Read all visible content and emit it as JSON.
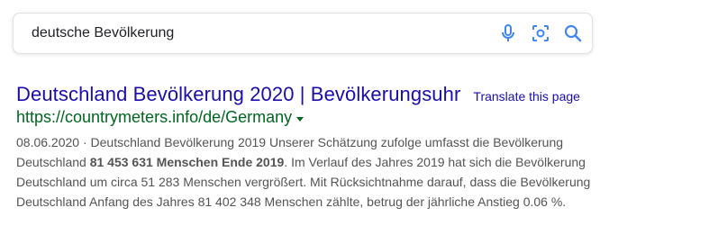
{
  "search": {
    "query": "deutsche Bevölkerung",
    "icons": [
      "microphone-icon",
      "lens-icon",
      "search-icon"
    ]
  },
  "result": {
    "title": "Deutschland Bevölkerung 2020 | Bevölkerungsuhr",
    "translate": "Translate this page",
    "url": "https://countrymeters.info/de/Germany",
    "snippet": {
      "line1": "08.06.2020 · Deutschland Bevölkerung 2019 Unserer Schätzung zufolge umfasst die Bevölkerung",
      "line2_pre": "Deutschland ",
      "line2_bold": "81 453 631 Menschen Ende 2019",
      "line2_post": ". Im Verlauf des Jahres 2019 hat sich die Bevölkerung",
      "line3": "Deutschland um circa 51 283 Menschen vergrößert. Mit Rücksichtnahme darauf, dass die Bevölkerung",
      "line4": "Deutschland Anfang des Jahres 81 402 348 Menschen zählte, betrug der jährliche Anstieg 0.06 %."
    }
  },
  "colors": {
    "title": "#1a0dab",
    "url": "#006621",
    "snippet": "#545454",
    "icon_blue": "#4285f4"
  }
}
